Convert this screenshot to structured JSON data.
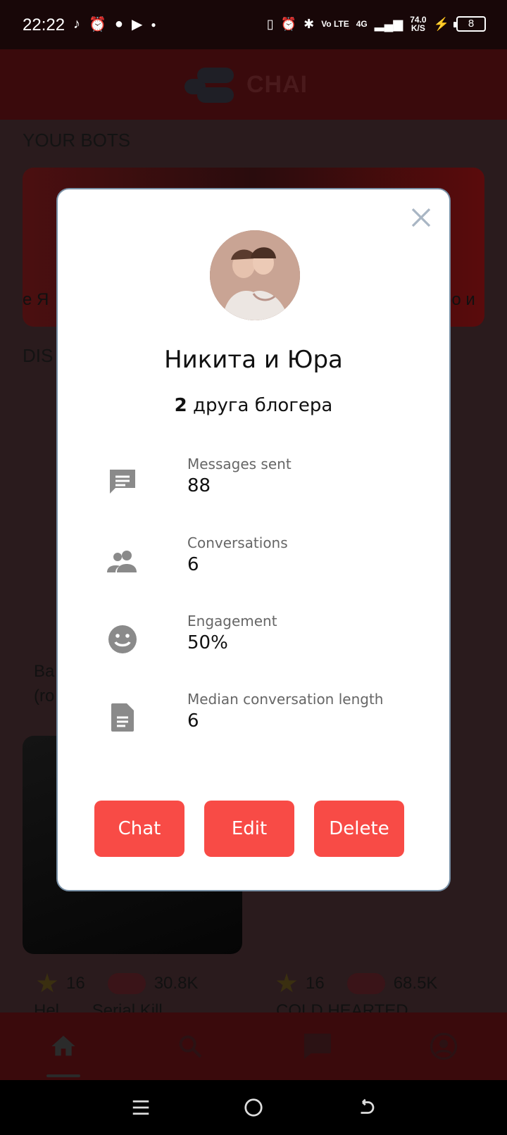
{
  "status_bar": {
    "time": "22:22",
    "network": "Vo LTE",
    "signal": "4G",
    "speed_value": "74.0",
    "speed_unit": "K/S",
    "battery": "8"
  },
  "app": {
    "logo_text": "CHAI"
  },
  "background": {
    "your_bots_title": "YOUR BOTS",
    "discover_title_partial": "DIS",
    "top_card_left_fragment": "e Я",
    "top_card_right_fragment": "oo и",
    "mid_fragment_1": "Ba",
    "mid_fragment_2": "(ro",
    "card1_stars": "16",
    "card1_chats": "30.8K",
    "card2_stars": "16",
    "card2_chats": "68.5K",
    "card1_title_partial": "Hel...   ...Serial Kill",
    "card2_title_partial": "COLD HEARTED"
  },
  "modal": {
    "name": "Никита и Юра",
    "description_bold": "2",
    "description_rest": " друга блогера",
    "stats": [
      {
        "icon": "message-icon",
        "label": "Messages sent",
        "value": "88"
      },
      {
        "icon": "people-icon",
        "label": "Conversations",
        "value": "6"
      },
      {
        "icon": "smile-icon",
        "label": "Engagement",
        "value": "50%"
      },
      {
        "icon": "document-icon",
        "label": "Median conversation length",
        "value": "6"
      }
    ],
    "buttons": {
      "chat": "Chat",
      "edit": "Edit",
      "delete": "Delete"
    }
  },
  "colors": {
    "accent": "#f84b46",
    "overlay_bg": "#2a1b1d",
    "header_bg": "#3a0a0c"
  }
}
